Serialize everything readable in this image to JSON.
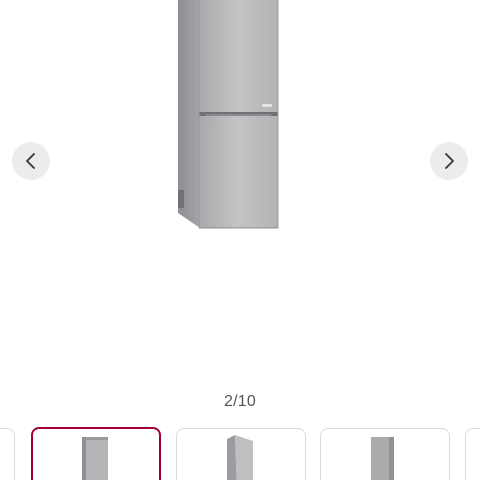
{
  "gallery": {
    "counter": "2/10",
    "current_index": 2,
    "total": 10,
    "accent_color": "#a50034",
    "prev_icon": "chevron-left-icon",
    "next_icon": "chevron-right-icon",
    "main_image": "refrigerator-front-view"
  },
  "thumbnails": [
    {
      "image": "refrigerator-partial",
      "active": false
    },
    {
      "image": "refrigerator-front",
      "active": true
    },
    {
      "image": "refrigerator-angled",
      "active": false
    },
    {
      "image": "refrigerator-side",
      "active": false
    },
    {
      "image": "refrigerator-partial",
      "active": false
    }
  ]
}
